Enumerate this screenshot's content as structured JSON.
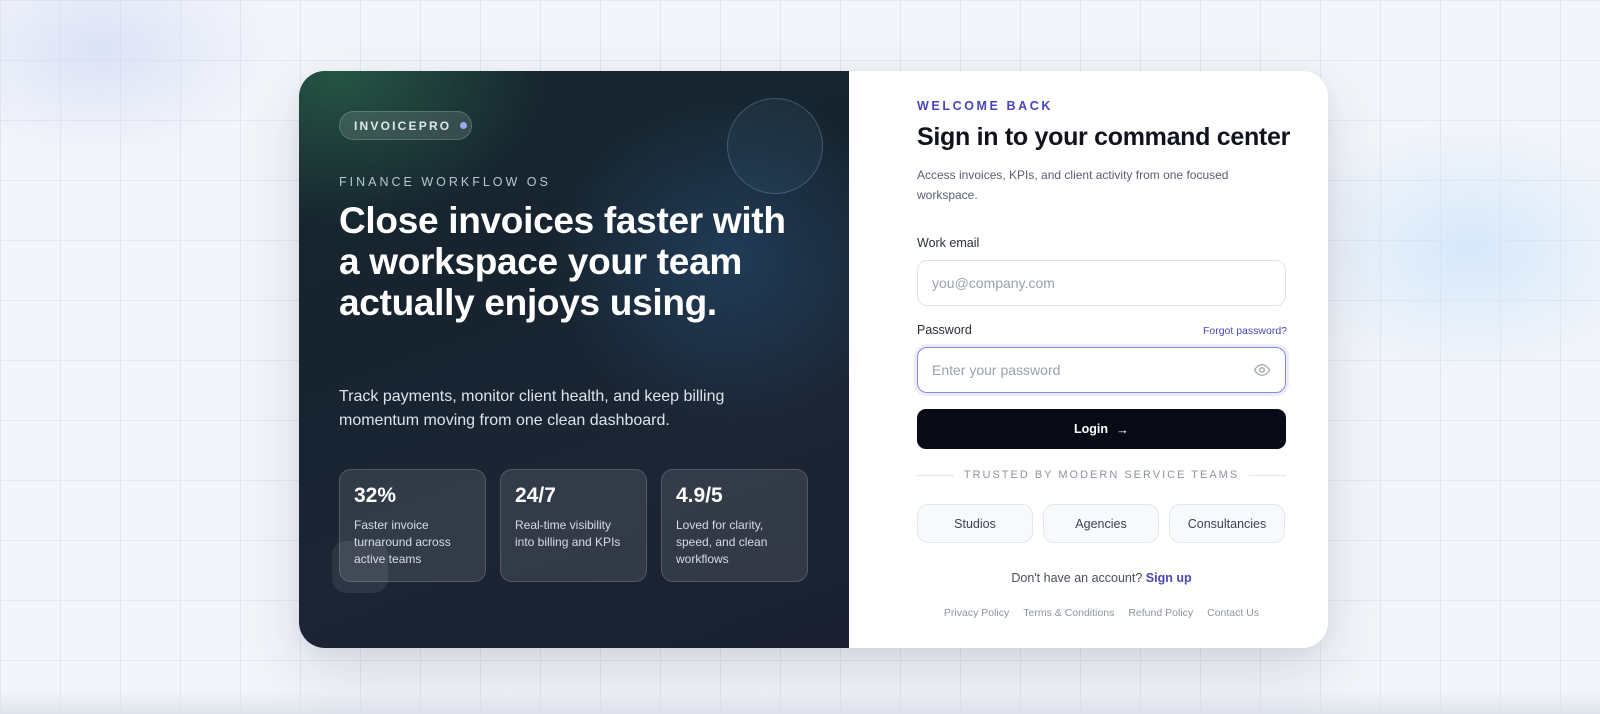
{
  "brand": {
    "name": "INVOICEPRO"
  },
  "hero": {
    "eyebrow": "FINANCE WORKFLOW OS",
    "headline": "Close invoices faster with a workspace your team actually enjoys using.",
    "subcopy": "Track payments, monitor client health, and keep billing momentum moving from one clean dashboard."
  },
  "stats": [
    {
      "value": "32%",
      "label": "Faster invoice turnaround across active teams"
    },
    {
      "value": "24/7",
      "label": "Real-time visibility into billing and KPIs"
    },
    {
      "value": "4.9/5",
      "label": "Loved for clarity, speed, and clean workflows"
    }
  ],
  "form": {
    "eyebrow": "WELCOME BACK",
    "title": "Sign in to your command center",
    "description": "Access invoices, KPIs, and client activity from one focused workspace.",
    "email_label": "Work email",
    "email_placeholder": "you@company.com",
    "email_value": "",
    "password_label": "Password",
    "forgot_label": "Forgot password?",
    "password_placeholder": "Enter your password",
    "password_value": "",
    "login_label": "Login",
    "trusted_label": "TRUSTED BY MODERN SERVICE TEAMS",
    "chips": [
      "Studios",
      "Agencies",
      "Consultancies"
    ],
    "signup_prompt": "Don't have an account?",
    "signup_link": "Sign up"
  },
  "footer": {
    "links": [
      "Privacy Policy",
      "Terms & Conditions",
      "Refund Policy",
      "Contact Us"
    ]
  },
  "colors": {
    "accent": "#4a46b8",
    "button_bg": "#080b16",
    "hero_bg": "#172430"
  },
  "icons": {
    "password_toggle": "eye-icon",
    "login_arrow": "arrow-right-icon"
  }
}
